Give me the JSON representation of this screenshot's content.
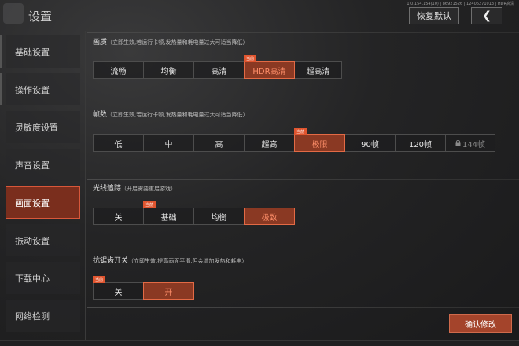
{
  "header": {
    "title": "设置",
    "version": "1.0.154.154(10) | 86921526 | 12406271013 | HDR高清",
    "reset_label": "恢复默认",
    "back_glyph": "❮"
  },
  "sidebar": {
    "items": [
      {
        "label": "基础设置"
      },
      {
        "label": "操作设置"
      },
      {
        "label": "灵敏度设置"
      },
      {
        "label": "声音设置"
      },
      {
        "label": "画面设置",
        "active": true
      },
      {
        "label": "振动设置"
      },
      {
        "label": "下载中心"
      },
      {
        "label": "网络检测"
      }
    ]
  },
  "badge_label": "当前",
  "sections": {
    "quality": {
      "title": "画质",
      "note": "（立即生效,若运行卡顿,发热量和耗电量过大可适当降低）",
      "options": [
        "流畅",
        "均衡",
        "高清",
        "HDR高清",
        "超高清"
      ],
      "selected": "HDR高清"
    },
    "framerate": {
      "title": "帧数",
      "note": "（立即生效,若运行卡顿,发热量和耗电量过大可适当降低）",
      "options": [
        "低",
        "中",
        "高",
        "超高",
        "极限",
        "90帧",
        "120帧",
        "144帧"
      ],
      "selected": "极限",
      "locked": "144帧"
    },
    "raytracing": {
      "title": "光线追踪",
      "note": "（开启需要重启游戏）",
      "options": [
        "关",
        "基础",
        "均衡",
        "极致"
      ],
      "selected": "极致",
      "current": "基础"
    },
    "antialias": {
      "title": "抗锯齿开关",
      "note": "（立即生效,提高画面平滑,但会增加发热和耗电）",
      "options": [
        "关",
        "开"
      ],
      "selected": "开",
      "current": "关"
    }
  },
  "footer": {
    "confirm_label": "确认修改"
  },
  "colors": {
    "accent": "#e0552f",
    "selected_bg": "#8a3923",
    "selected_text": "#ff8f6a",
    "sidebar_active": "#7a2e1d"
  },
  "icons": [
    "lock-icon",
    "back-arrow-icon",
    "logo-icon"
  ]
}
